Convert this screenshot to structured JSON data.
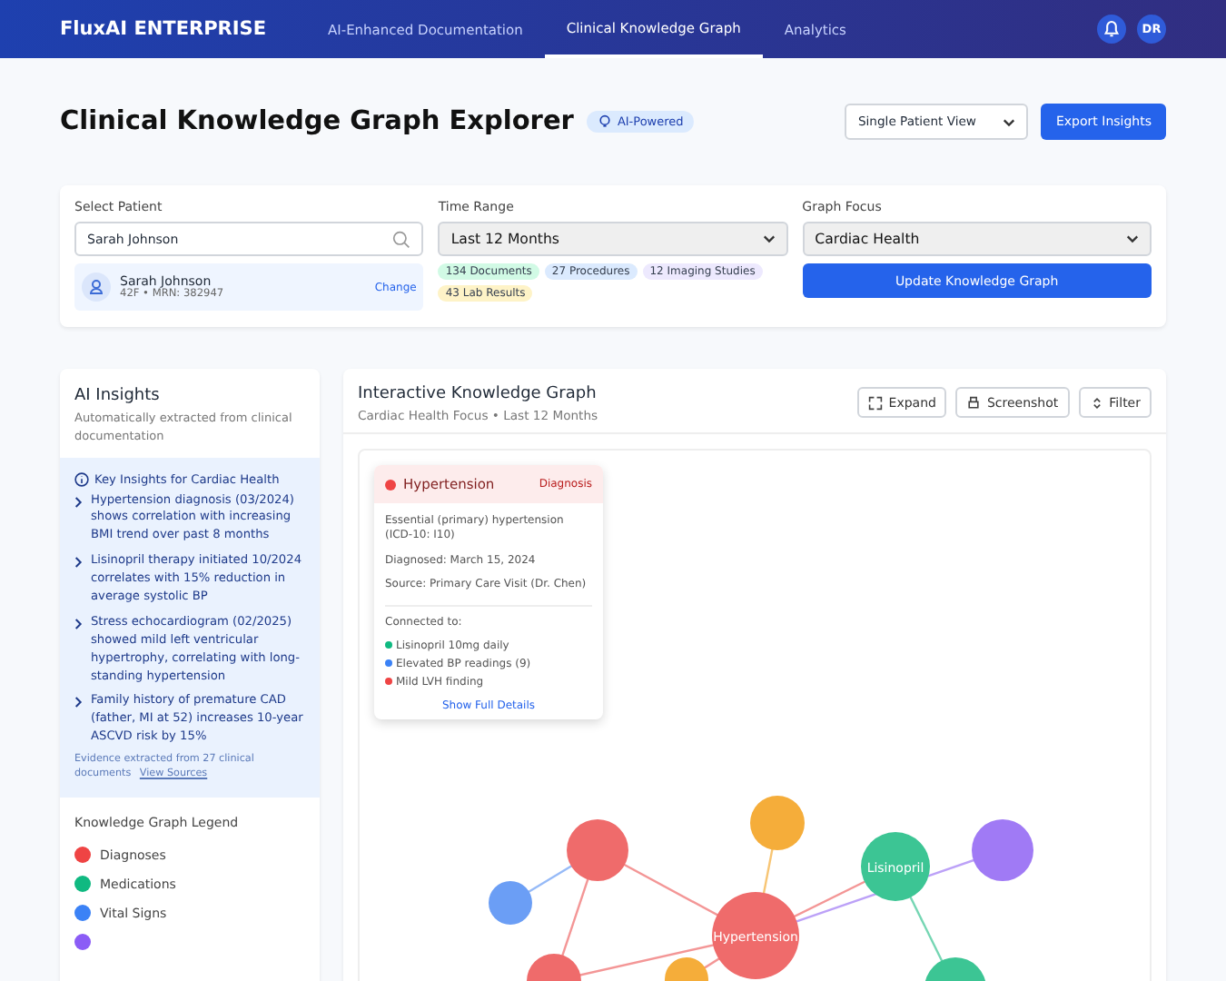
{
  "nav": {
    "brand": "FluxAI ENTERPRISE",
    "tabs": [
      {
        "label": "AI-Enhanced Documentation",
        "selected": false
      },
      {
        "label": "Clinical Knowledge Graph",
        "selected": true
      },
      {
        "label": "Analytics",
        "selected": false
      }
    ],
    "avatar": "DR"
  },
  "page": {
    "title": "Clinical Knowledge Graph Explorer",
    "badge": "AI-Powered",
    "view_select": "Single Patient View",
    "export_button": "Export Insights"
  },
  "filters": {
    "patient_label": "Select Patient",
    "patient_value": "Sarah Johnson",
    "patient_name": "Sarah Johnson",
    "patient_meta": "42F • MRN: 382947",
    "change_link": "Change",
    "time_label": "Time Range",
    "time_value": "Last 12 Months",
    "tags": [
      {
        "label": "134 Documents",
        "color": "#d1fae5"
      },
      {
        "label": "27 Procedures",
        "color": "#dbeafe"
      },
      {
        "label": "12 Imaging Studies",
        "color": "#ede9fe"
      },
      {
        "label": "43 Lab Results",
        "color": "#fef3c7"
      }
    ],
    "focus_label": "Graph Focus",
    "focus_value": "Cardiac Health",
    "update_button": "Update Knowledge Graph"
  },
  "insights": {
    "title": "AI Insights",
    "subtitle": "Automatically extracted from clinical documentation",
    "heading": "Key Insights for Cardiac Health",
    "items": [
      "Hypertension diagnosis (03/2024) shows correlation with increasing BMI trend over past 8 months",
      "Lisinopril therapy initiated 10/2024 correlates with 15% reduction in average systolic BP",
      "Stress echocardiogram (02/2025) showed mild left ventricular hypertrophy, correlating with long-standing hypertension",
      "Family history of premature CAD (father, MI at 52) increases 10-year ASCVD risk by 15%"
    ],
    "evidence": "Evidence extracted from 27 clinical documents",
    "sources_link": "View Sources"
  },
  "legend": {
    "title": "Knowledge Graph Legend",
    "items": [
      {
        "label": "Diagnoses",
        "color": "#ef4444"
      },
      {
        "label": "Medications",
        "color": "#10b981"
      },
      {
        "label": "Vital Signs",
        "color": "#3b82f6"
      },
      {
        "color": "#8b5cf6"
      }
    ]
  },
  "graph": {
    "title": "Interactive Knowledge Graph",
    "subtitle": "Cardiac Health Focus • Last 12 Months",
    "buttons": [
      "Expand",
      "Screenshot",
      "Filter"
    ],
    "popup": {
      "name": "Hypertension",
      "type": "Diagnosis",
      "description": "Essential (primary) hypertension (ICD-10: I10)",
      "diagnosed_label": "Diagnosed:",
      "diagnosed": "March 15, 2024",
      "source_label": "Source:",
      "source": "Primary Care Visit (Dr. Chen)",
      "connected_label": "Connected to:",
      "connections": [
        {
          "label": "Lisinopril 10mg daily",
          "color": "#10b981"
        },
        {
          "label": "Elevated BP readings (9)",
          "color": "#3b82f6"
        },
        {
          "label": "Mild LVH finding",
          "color": "#ef4444"
        }
      ],
      "details_link": "Show Full Details"
    },
    "nodes": [
      {
        "color": "#ef6b6b"
      },
      {
        "color": "#6b9ef5"
      },
      {
        "color": "#f5ad3a"
      },
      {
        "color": "#ef6b6b",
        "label": "Hypertension"
      },
      {
        "color": "#3cc594",
        "label": "Lisinopril"
      },
      {
        "color": "#a07af5"
      },
      {
        "color": "#3cc594"
      },
      {
        "color": "#ef6b6b"
      },
      {
        "color": "#f5ad3a"
      }
    ]
  }
}
